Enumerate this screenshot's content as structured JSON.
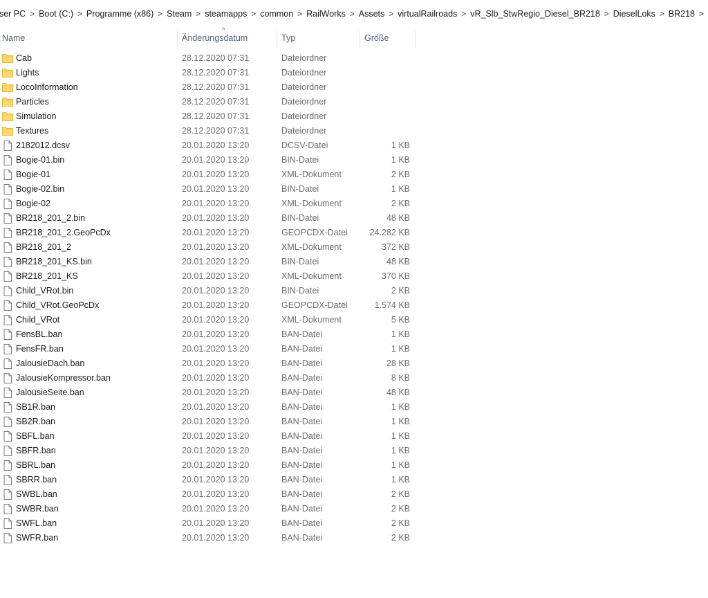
{
  "breadcrumb": [
    "eser PC",
    "Boot (C:)",
    "Programme (x86)",
    "Steam",
    "steamapps",
    "common",
    "RailWorks",
    "Assets",
    "virtualRailroads",
    "vR_Slb_StwRegio_Diesel_BR218",
    "DieselLoks",
    "BR218"
  ],
  "breadcrumb_separator": ">",
  "columns": {
    "name": "Name",
    "date": "Änderungsdatum",
    "type": "Typ",
    "size": "Größe",
    "sort_indicator": "^"
  },
  "colors": {
    "folder": "#ffd86a",
    "folder_dark": "#e6b84a",
    "header_text": "#4c607a",
    "secondary_text": "#6d6d6d"
  },
  "files": [
    {
      "icon": "folder-icon",
      "name": "Cab",
      "date": "28.12.2020 07:31",
      "type": "Dateiordner",
      "size": ""
    },
    {
      "icon": "folder-icon",
      "name": "Lights",
      "date": "28.12.2020 07:31",
      "type": "Dateiordner",
      "size": ""
    },
    {
      "icon": "folder-icon",
      "name": "LocoInformation",
      "date": "28.12.2020 07:31",
      "type": "Dateiordner",
      "size": ""
    },
    {
      "icon": "folder-icon",
      "name": "Particles",
      "date": "28.12.2020 07:31",
      "type": "Dateiordner",
      "size": ""
    },
    {
      "icon": "folder-icon",
      "name": "Simulation",
      "date": "28.12.2020 07:31",
      "type": "Dateiordner",
      "size": ""
    },
    {
      "icon": "folder-icon",
      "name": "Textures",
      "date": "28.12.2020 07:31",
      "type": "Dateiordner",
      "size": ""
    },
    {
      "icon": "file-icon",
      "name": "2182012.dcsv",
      "date": "20.01.2020 13:20",
      "type": "DCSV-Datei",
      "size": "1 KB"
    },
    {
      "icon": "file-icon",
      "name": "Bogie-01.bin",
      "date": "20.01.2020 13:20",
      "type": "BIN-Datei",
      "size": "1 KB"
    },
    {
      "icon": "file-icon",
      "name": "Bogie-01",
      "date": "20.01.2020 13:20",
      "type": "XML-Dokument",
      "size": "2 KB"
    },
    {
      "icon": "file-icon",
      "name": "Bogie-02.bin",
      "date": "20.01.2020 13:20",
      "type": "BIN-Datei",
      "size": "1 KB"
    },
    {
      "icon": "file-icon",
      "name": "Bogie-02",
      "date": "20.01.2020 13:20",
      "type": "XML-Dokument",
      "size": "2 KB"
    },
    {
      "icon": "file-icon",
      "name": "BR218_201_2.bin",
      "date": "20.01.2020 13:20",
      "type": "BIN-Datei",
      "size": "48 KB"
    },
    {
      "icon": "file-icon",
      "name": "BR218_201_2.GeoPcDx",
      "date": "20.01.2020 13:20",
      "type": "GEOPCDX-Datei",
      "size": "24.282 KB"
    },
    {
      "icon": "file-icon",
      "name": "BR218_201_2",
      "date": "20.01.2020 13:20",
      "type": "XML-Dokument",
      "size": "372 KB"
    },
    {
      "icon": "file-icon",
      "name": "BR218_201_KS.bin",
      "date": "20.01.2020 13:20",
      "type": "BIN-Datei",
      "size": "48 KB"
    },
    {
      "icon": "file-icon",
      "name": "BR218_201_KS",
      "date": "20.01.2020 13:20",
      "type": "XML-Dokument",
      "size": "370 KB"
    },
    {
      "icon": "file-icon",
      "name": "Child_VRot.bin",
      "date": "20.01.2020 13:20",
      "type": "BIN-Datei",
      "size": "2 KB"
    },
    {
      "icon": "file-icon",
      "name": "Child_VRot.GeoPcDx",
      "date": "20.01.2020 13:20",
      "type": "GEOPCDX-Datei",
      "size": "1.574 KB"
    },
    {
      "icon": "file-icon",
      "name": "Child_VRot",
      "date": "20.01.2020 13:20",
      "type": "XML-Dokument",
      "size": "5 KB"
    },
    {
      "icon": "file-icon",
      "name": "FensBL.ban",
      "date": "20.01.2020 13:20",
      "type": "BAN-Datei",
      "size": "1 KB"
    },
    {
      "icon": "file-icon",
      "name": "FensFR.ban",
      "date": "20.01.2020 13:20",
      "type": "BAN-Datei",
      "size": "1 KB"
    },
    {
      "icon": "file-icon",
      "name": "JalousieDach.ban",
      "date": "20.01.2020 13:20",
      "type": "BAN-Datei",
      "size": "28 KB"
    },
    {
      "icon": "file-icon",
      "name": "JalousieKompressor.ban",
      "date": "20.01.2020 13:20",
      "type": "BAN-Datei",
      "size": "8 KB"
    },
    {
      "icon": "file-icon",
      "name": "JalousieSeite.ban",
      "date": "20.01.2020 13:20",
      "type": "BAN-Datei",
      "size": "48 KB"
    },
    {
      "icon": "file-icon",
      "name": "SB1R.ban",
      "date": "20.01.2020 13:20",
      "type": "BAN-Datei",
      "size": "1 KB"
    },
    {
      "icon": "file-icon",
      "name": "SB2R.ban",
      "date": "20.01.2020 13:20",
      "type": "BAN-Datei",
      "size": "1 KB"
    },
    {
      "icon": "file-icon",
      "name": "SBFL.ban",
      "date": "20.01.2020 13:20",
      "type": "BAN-Datei",
      "size": "1 KB"
    },
    {
      "icon": "file-icon",
      "name": "SBFR.ban",
      "date": "20.01.2020 13:20",
      "type": "BAN-Datei",
      "size": "1 KB"
    },
    {
      "icon": "file-icon",
      "name": "SBRL.ban",
      "date": "20.01.2020 13:20",
      "type": "BAN-Datei",
      "size": "1 KB"
    },
    {
      "icon": "file-icon",
      "name": "SBRR.ban",
      "date": "20.01.2020 13:20",
      "type": "BAN-Datei",
      "size": "1 KB"
    },
    {
      "icon": "file-icon",
      "name": "SWBL.ban",
      "date": "20.01.2020 13:20",
      "type": "BAN-Datei",
      "size": "2 KB"
    },
    {
      "icon": "file-icon",
      "name": "SWBR.ban",
      "date": "20.01.2020 13:20",
      "type": "BAN-Datei",
      "size": "2 KB"
    },
    {
      "icon": "file-icon",
      "name": "SWFL.ban",
      "date": "20.01.2020 13:20",
      "type": "BAN-Datei",
      "size": "2 KB"
    },
    {
      "icon": "file-icon",
      "name": "SWFR.ban",
      "date": "20.01.2020 13:20",
      "type": "BAN-Datei",
      "size": "2 KB"
    }
  ]
}
